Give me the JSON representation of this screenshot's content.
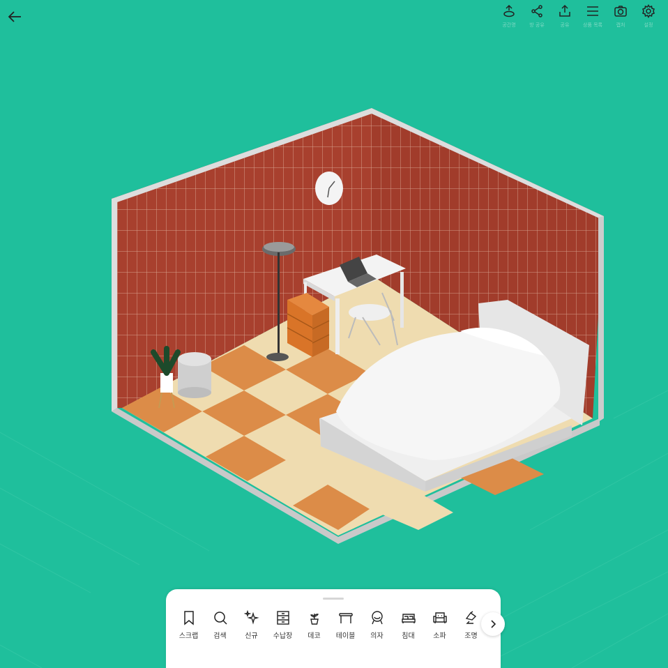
{
  "colors": {
    "background": "#1fbf9c",
    "wall": "#a8402e",
    "floor_light": "#efdcb0",
    "floor_dark": "#dc8c48",
    "room_border": "#d8d8d8"
  },
  "header": {
    "back_icon": "arrow-left-icon",
    "tools": [
      {
        "icon": "pin-icon",
        "label": "공간명"
      },
      {
        "icon": "share-nodes-icon",
        "label": "방 공유"
      },
      {
        "icon": "upload-icon",
        "label": "공유"
      },
      {
        "icon": "list-icon",
        "label": "상품 목록"
      },
      {
        "icon": "camera-icon",
        "label": "캡처"
      },
      {
        "icon": "gear-icon",
        "label": "설정"
      }
    ]
  },
  "toolbar": {
    "categories": [
      {
        "icon": "bookmark-icon",
        "label": "스크랩"
      },
      {
        "icon": "search-icon",
        "label": "검색"
      },
      {
        "icon": "sparkle-icon",
        "label": "신규"
      },
      {
        "icon": "drawer-icon",
        "label": "수납장"
      },
      {
        "icon": "plant-icon",
        "label": "데코"
      },
      {
        "icon": "table-icon",
        "label": "테이블"
      },
      {
        "icon": "chair-icon",
        "label": "의자"
      },
      {
        "icon": "bed-icon",
        "label": "침대"
      },
      {
        "icon": "sofa-icon",
        "label": "소파"
      },
      {
        "icon": "lamp-icon",
        "label": "조명"
      }
    ],
    "next_icon": "chevron-right-icon"
  }
}
